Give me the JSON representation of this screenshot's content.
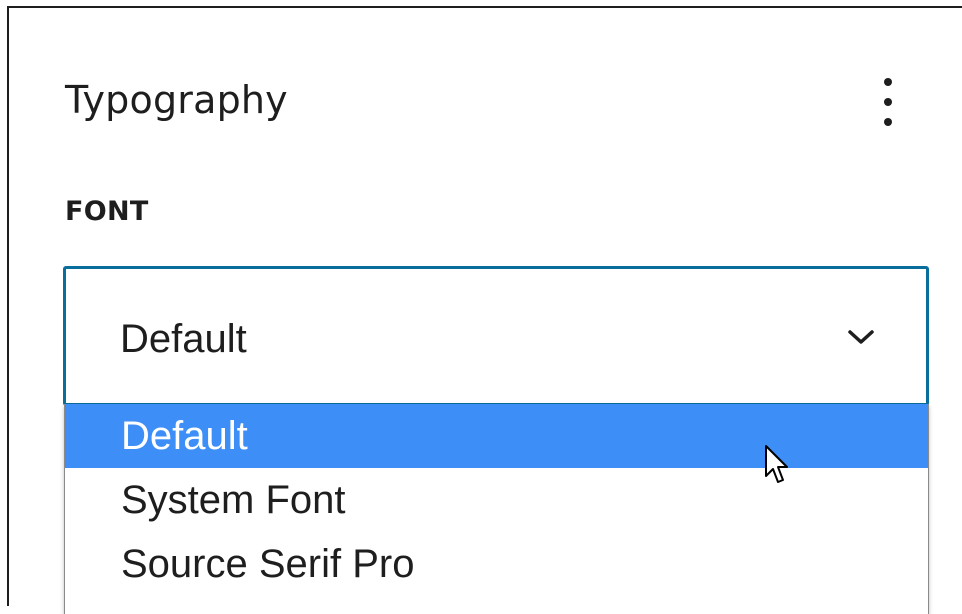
{
  "panel": {
    "title": "Typography",
    "menu_icon": "more-vertical-icon"
  },
  "font": {
    "label": "FONT",
    "selected_value": "Default",
    "chevron_icon": "chevron-down-icon",
    "options": [
      {
        "label": "Default",
        "selected": true
      },
      {
        "label": "System Font",
        "selected": false
      },
      {
        "label": "Source Serif Pro",
        "selected": false
      }
    ]
  },
  "colors": {
    "accent_border": "#0a6e9c",
    "highlight": "#3d8ef7",
    "text": "#1e1e1e"
  },
  "cursor_icon": "mouse-pointer-icon"
}
